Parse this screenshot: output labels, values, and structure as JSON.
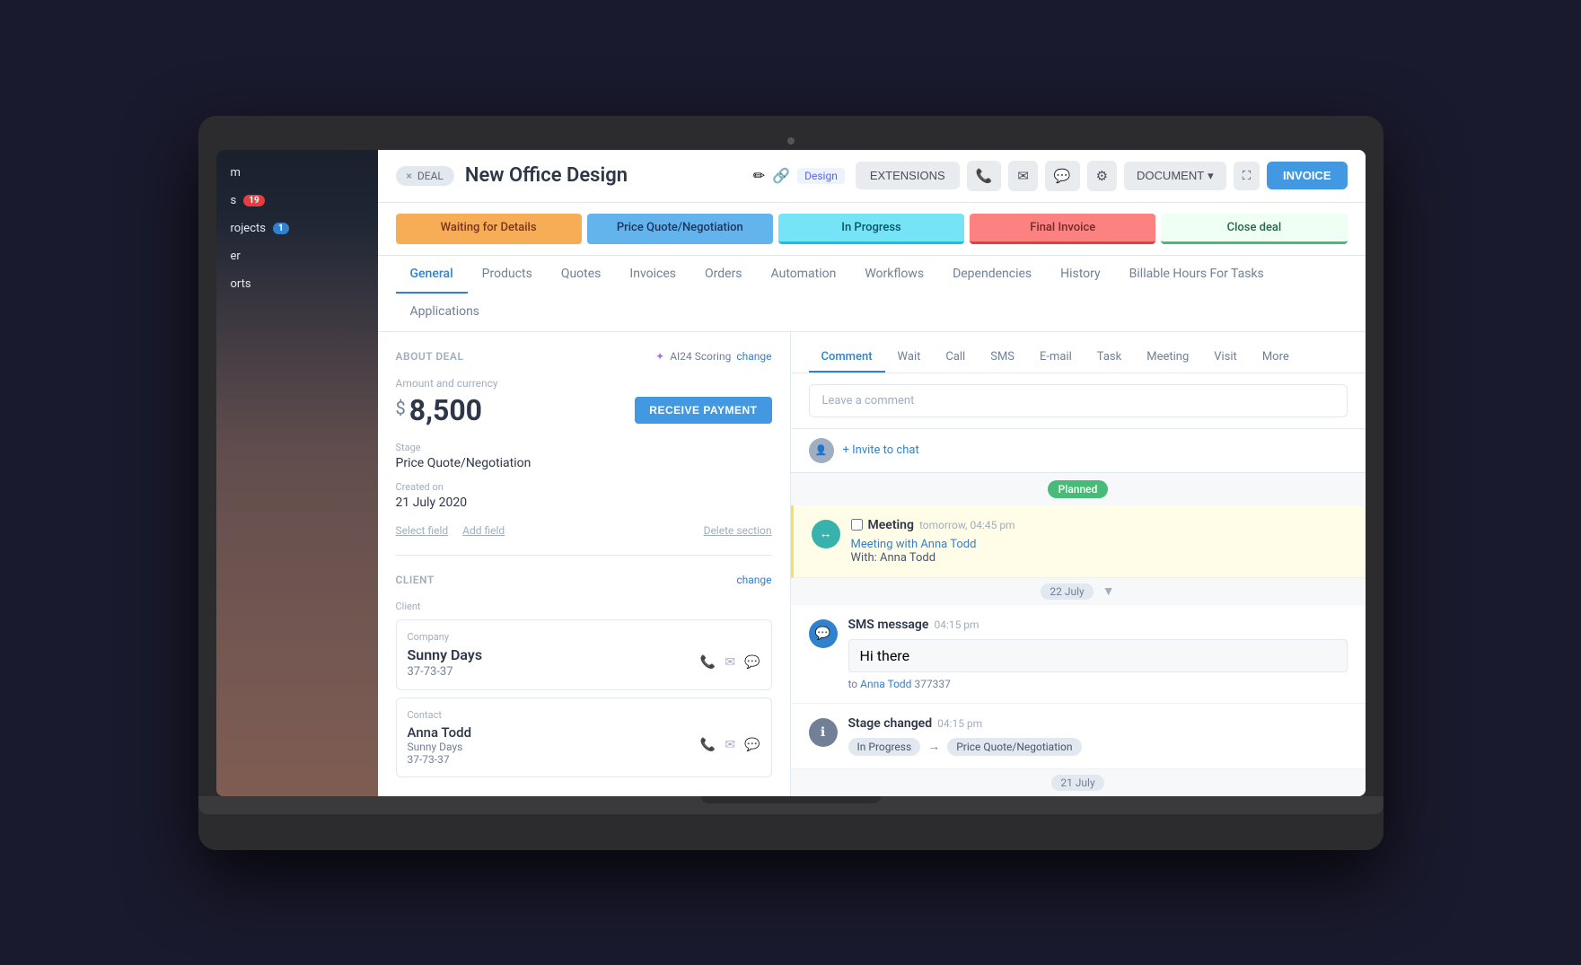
{
  "app": {
    "deal_tag": "DEAL",
    "page_title": "New Office Design",
    "edit_icon": "✏",
    "link_icon": "🔗",
    "design_tag": "Design",
    "close_deal_tag": "×"
  },
  "toolbar": {
    "extensions_label": "EXTENSIONS",
    "phone_icon": "📞",
    "email_icon": "✉",
    "chat_icon": "💬",
    "settings_icon": "⚙",
    "document_label": "DOCUMENT",
    "expand_icon": "⛶",
    "invoice_label": "INVOICE"
  },
  "pipeline": {
    "stages": [
      {
        "label": "Waiting for Details",
        "class": "stage-orange"
      },
      {
        "label": "Price Quote/Negotiation",
        "class": "stage-blue-light"
      },
      {
        "label": "In Progress",
        "class": "stage-cyan"
      },
      {
        "label": "Final Invoice",
        "class": "stage-red"
      },
      {
        "label": "Close deal",
        "class": "stage-green"
      }
    ]
  },
  "tabs": {
    "items": [
      {
        "label": "General",
        "active": true
      },
      {
        "label": "Products"
      },
      {
        "label": "Quotes"
      },
      {
        "label": "Invoices"
      },
      {
        "label": "Orders"
      },
      {
        "label": "Automation"
      },
      {
        "label": "Workflows"
      },
      {
        "label": "Dependencies"
      },
      {
        "label": "History"
      },
      {
        "label": "Billable Hours For Tasks"
      },
      {
        "label": "Applications"
      }
    ]
  },
  "about_deal": {
    "section_title": "ABOUT DEAL",
    "change_label": "change",
    "ai_scoring_label": "AI24 Scoring",
    "ai_change_label": "change",
    "amount_label": "Amount and currency",
    "currency_symbol": "$",
    "amount_value": "8,500",
    "receive_payment_label": "RECEIVE PAYMENT",
    "stage_label": "Stage",
    "stage_value": "Price Quote/Negotiation",
    "created_label": "Created on",
    "created_value": "21 July 2020",
    "select_field_label": "Select field",
    "add_field_label": "Add field",
    "delete_section_label": "Delete section"
  },
  "client": {
    "section_title": "CLIENT",
    "change_label": "change",
    "client_label": "Client",
    "company_label": "Company",
    "company_name": "Sunny Days",
    "company_phone": "37-73-37",
    "contact_label": "Contact",
    "contact_name": "Anna Todd",
    "contact_company": "Sunny Days",
    "contact_phone": "37-73-37"
  },
  "activity": {
    "tabs": [
      "Comment",
      "Wait",
      "Call",
      "SMS",
      "E-mail",
      "Task",
      "Meeting",
      "Visit",
      "More"
    ],
    "active_tab": "Comment",
    "comment_placeholder": "Leave a comment",
    "invite_text": "+ Invite to chat",
    "planned_label": "Planned",
    "meeting": {
      "title": "Meeting",
      "time": "tomorrow, 04:45 pm",
      "meeting_name": "Meeting with Anna Todd",
      "with_label": "With:",
      "with_name": "Anna Todd"
    },
    "date_22_july": "22 July",
    "sms": {
      "title": "SMS message",
      "time": "04:15 pm",
      "body": "Hi there",
      "to_label": "to",
      "to_name": "Anna Todd",
      "to_phone": "377337"
    },
    "stage_change": {
      "title": "Stage changed",
      "time": "04:15 pm",
      "from_stage": "In Progress",
      "arrow": "→",
      "to_stage": "Price Quote/Negotiation"
    },
    "date_21_july": "21 July"
  },
  "sidebar": {
    "items": [
      {
        "label": "m"
      },
      {
        "label": "s",
        "badge": "19"
      },
      {
        "label": "rojects",
        "badge": "1",
        "badge_class": "blue"
      },
      {
        "label": "er"
      },
      {
        "label": "orts"
      }
    ]
  }
}
